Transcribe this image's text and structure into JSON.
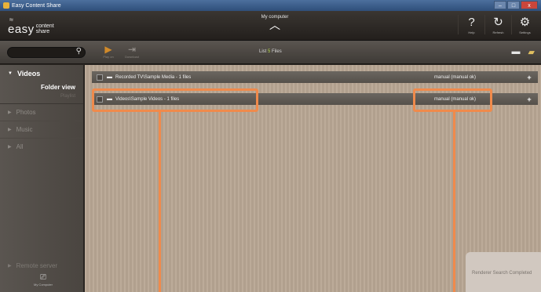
{
  "window": {
    "title": "Easy Content Share",
    "controls": [
      "–",
      "□",
      "x"
    ]
  },
  "header": {
    "logo_easy": "easy",
    "logo_content": "content",
    "logo_share": "share",
    "device_label": "My computer",
    "device_chevron": "^",
    "actions": [
      {
        "label": "Help",
        "glyph": "?",
        "icon": "help-icon"
      },
      {
        "label": "Refresh",
        "glyph": "↻",
        "icon": "refresh-icon"
      },
      {
        "label": "Settings",
        "glyph": "⚙",
        "icon": "settings-icon"
      }
    ]
  },
  "toolbar": {
    "search_placeholder": "",
    "play_label": "Play on",
    "download_label": "Download",
    "files_prefix": "List",
    "files_count": "5",
    "files_suffix": "Files",
    "add_folder_icon": "folder-icon",
    "open_folder_icon": "open-folder-icon"
  },
  "sidebar": {
    "videos_label": "Videos",
    "folder_view_label": "Folder view",
    "playlist_label": "Playlist",
    "items": [
      {
        "label": "Photos"
      },
      {
        "label": "Music"
      },
      {
        "label": "All"
      }
    ],
    "remote_label": "Remote server",
    "my_computer_label": "My Computer"
  },
  "main": {
    "rows": [
      {
        "name": "Recorded TV\\Sample Media - 1 files",
        "mode": "manual (manual ok)",
        "add": "+"
      },
      {
        "name": "Videos\\Sample Videos - 1 files",
        "mode": "manual (manual ok)",
        "add": "+"
      }
    ],
    "toast": "Renderer Search Completed"
  },
  "colors": {
    "highlight": "#f08a4b",
    "files_count": "#b6d94a",
    "play_accent": "#d18a2a"
  }
}
